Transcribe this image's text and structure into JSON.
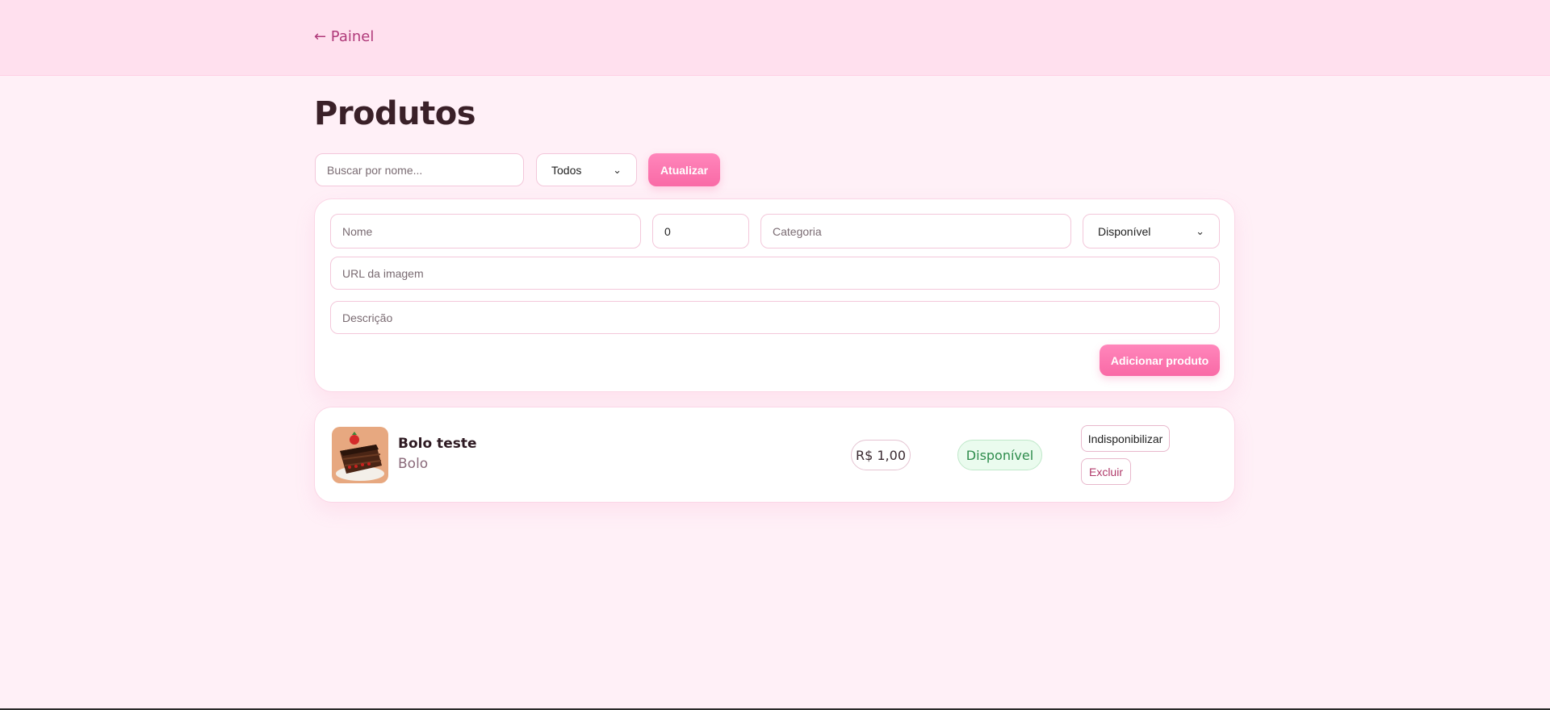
{
  "header": {
    "back_link": "← Painel"
  },
  "page": {
    "title": "Produtos"
  },
  "toolbar": {
    "search_placeholder": "Buscar por nome...",
    "filter_selected": "Todos",
    "refresh_label": "Atualizar"
  },
  "form": {
    "name_placeholder": "Nome",
    "price_value": "0",
    "category_placeholder": "Categoria",
    "availability_selected": "Disponível",
    "image_url_placeholder": "URL da imagem",
    "description_placeholder": "Descrição",
    "submit_label": "Adicionar produto"
  },
  "products": [
    {
      "name": "Bolo teste",
      "category": "Bolo",
      "price": "R$ 1,00",
      "status": "Disponível",
      "toggle_label": "Indisponibilizar",
      "delete_label": "Excluir"
    }
  ],
  "colors": {
    "accent": "#f96aa6",
    "header_bg": "#ffe0ee",
    "page_bg": "#fff0f7",
    "status_available": "#2e8c4c"
  }
}
